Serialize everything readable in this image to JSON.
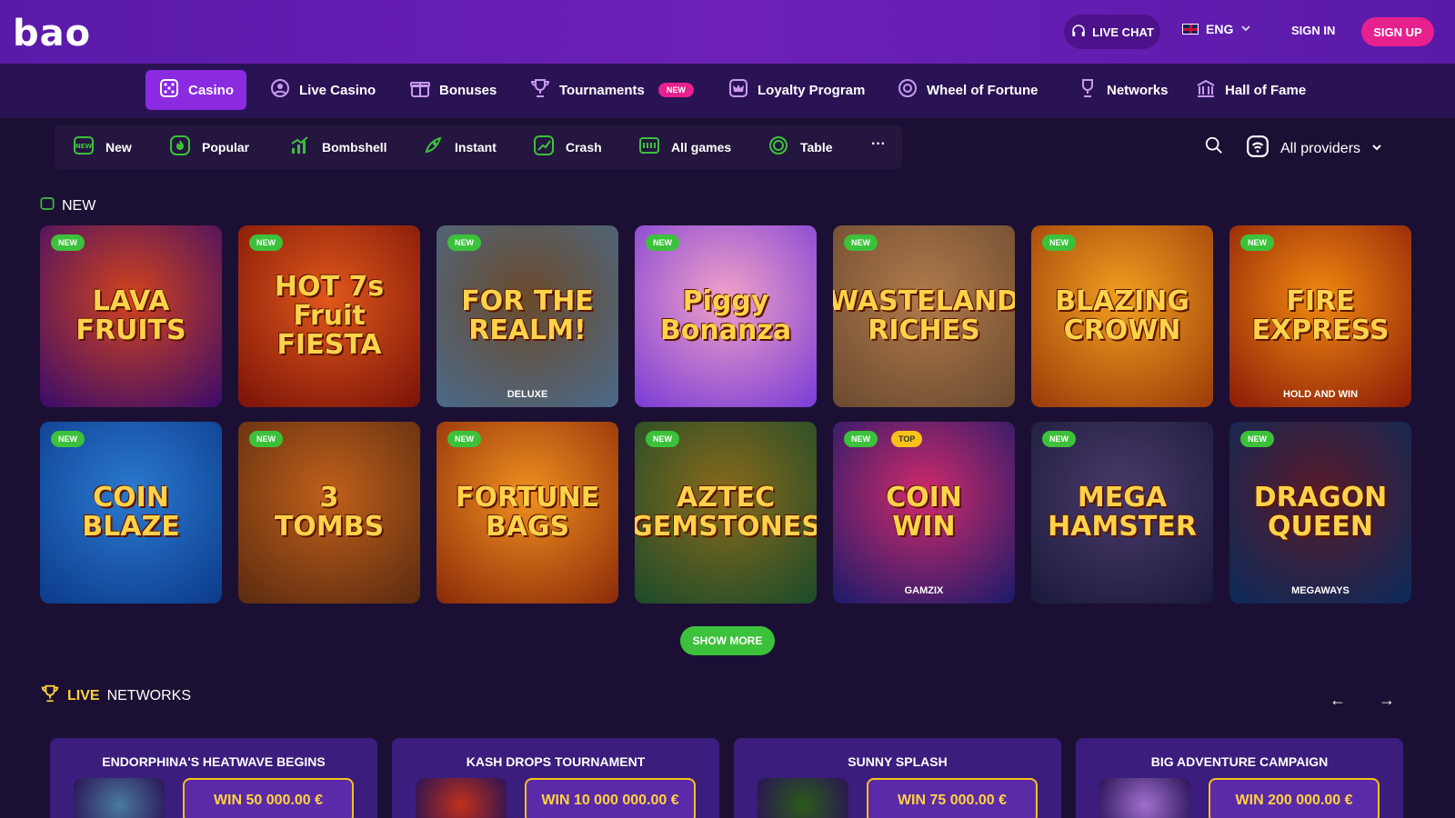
{
  "header": {
    "logo": "bao",
    "live_chat": "LIVE CHAT",
    "language": "ENG",
    "sign_in": "SIGN IN",
    "sign_up": "SIGN UP"
  },
  "main_nav": {
    "items": [
      {
        "label": "Casino"
      },
      {
        "label": "Live Casino"
      },
      {
        "label": "Bonuses"
      },
      {
        "label": "Tournaments",
        "badge": "NEW"
      },
      {
        "label": "Loyalty Program"
      },
      {
        "label": "Wheel of Fortune"
      },
      {
        "label": "Networks"
      },
      {
        "label": "Hall of Fame"
      }
    ]
  },
  "categories": {
    "items": [
      {
        "label": "New"
      },
      {
        "label": "Popular"
      },
      {
        "label": "Bombshell"
      },
      {
        "label": "Instant"
      },
      {
        "label": "Crash"
      },
      {
        "label": "All games"
      },
      {
        "label": "Table"
      }
    ],
    "more": "···",
    "providers": "All providers"
  },
  "new_section": {
    "title": "NEW",
    "tag_new": "NEW",
    "tag_top": "TOP",
    "games": [
      {
        "name": "LAVA\nFRUITS",
        "colors": [
          "#3a0b6b",
          "#d2431c"
        ]
      },
      {
        "name": "HOT 7s\nFruit\nFIESTA",
        "colors": [
          "#7a1208",
          "#e0581a"
        ]
      },
      {
        "name": "FOR THE\nREALM!",
        "sub": "DELUXE",
        "colors": [
          "#4a6a8a",
          "#6b4a2a"
        ]
      },
      {
        "name": "Piggy\nBonanza",
        "colors": [
          "#7a3bd6",
          "#f0a2c8"
        ]
      },
      {
        "name": "WASTELAND\nRICHES",
        "colors": [
          "#6a4a30",
          "#b07a4a"
        ]
      },
      {
        "name": "BLAZING\nCROWN",
        "colors": [
          "#9a3a08",
          "#f0a020"
        ]
      },
      {
        "name": "FIRE\nEXPRESS",
        "sub": "HOLD AND WIN",
        "colors": [
          "#8a1a08",
          "#f08a10"
        ]
      },
      {
        "name": "COIN\nBLAZE",
        "colors": [
          "#0c3a8a",
          "#2a7ad0"
        ]
      },
      {
        "name": "3\nTOMBS",
        "colors": [
          "#5a2a10",
          "#c0601a"
        ]
      },
      {
        "name": "FORTUNE\nBAGS",
        "colors": [
          "#8a2a08",
          "#f09020"
        ]
      },
      {
        "name": "AZTEC\nGEMSTONES",
        "colors": [
          "#1a4a2a",
          "#8a6a1a"
        ]
      },
      {
        "name": "COIN\nWIN",
        "sub": "GAMZIX",
        "top": true,
        "colors": [
          "#1a1a6a",
          "#d02a6a"
        ]
      },
      {
        "name": "MEGA\nHAMSTER",
        "colors": [
          "#1a1a3a",
          "#4a3a6a"
        ]
      },
      {
        "name": "DRAGON\nQUEEN",
        "sub": "MEGAWAYS",
        "colors": [
          "#0a2a5a",
          "#5a1a2a"
        ]
      }
    ]
  },
  "show_more": "SHOW MORE",
  "networks": {
    "live_label": "LIVE",
    "title": "NETWORKS",
    "prev": "←",
    "next": "→",
    "cards": [
      {
        "title": "ENDORPHINA'S HEATWAVE BEGINS",
        "win": "WIN 50 000.00 €",
        "thumb": "#4a7aa0"
      },
      {
        "title": "KASH DROPS TOURNAMENT",
        "win": "WIN 10 000 000.00 €",
        "thumb": "#c0301a"
      },
      {
        "title": "SUNNY SPLASH",
        "win": "WIN 75 000.00 €",
        "thumb": "#2a5a1a"
      },
      {
        "title": "BIG ADVENTURE CAMPAIGN",
        "win": "WIN 200 000.00 €",
        "thumb": "#a070d0"
      }
    ]
  },
  "colors": {
    "accent_purple": "#8a2be2",
    "signup_pink": "#e6208d",
    "new_green": "#3cc13b",
    "gold": "#ffd23f"
  }
}
